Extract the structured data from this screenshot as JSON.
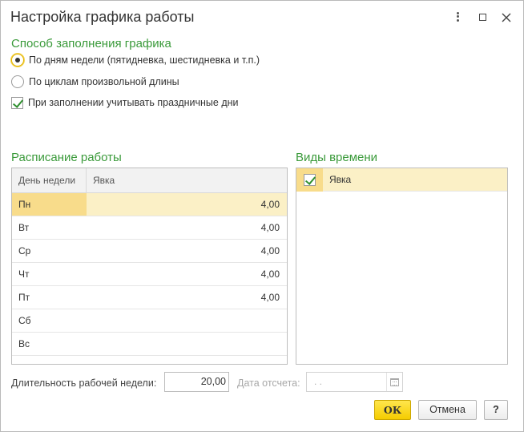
{
  "window": {
    "title": "Настройка графика работы",
    "controls": {
      "more_icon": "vertical-dots-icon",
      "maximize_icon": "maximize-icon",
      "close_icon": "close-icon"
    }
  },
  "fill_method": {
    "title": "Способ заполнения графика",
    "option_by_weekdays": "По дням недели (пятидневка, шестидневка и т.п.)",
    "option_by_cycles": "По циклам произвольной длины",
    "selected": "option_by_weekdays",
    "holidays_checkbox": {
      "label": "При заполнении учитывать праздничные дни",
      "checked": true
    }
  },
  "schedule": {
    "title": "Расписание работы",
    "columns": {
      "day": "День недели",
      "value": "Явка"
    },
    "rows": [
      {
        "day": "Пн",
        "value": "4,00"
      },
      {
        "day": "Вт",
        "value": "4,00"
      },
      {
        "day": "Ср",
        "value": "4,00"
      },
      {
        "day": "Чт",
        "value": "4,00"
      },
      {
        "day": "Пт",
        "value": "4,00"
      },
      {
        "day": "Сб",
        "value": ""
      },
      {
        "day": "Вс",
        "value": ""
      }
    ],
    "active_row": 0
  },
  "time_types": {
    "title": "Виды времени",
    "items": [
      {
        "label": "Явка",
        "checked": true
      }
    ]
  },
  "footer": {
    "duration_label": "Длительность рабочей недели:",
    "duration_value": "20,00",
    "date_label": "Дата отсчета:",
    "date_value": " .  .",
    "ok_label": "ОК",
    "cancel_label": "Отмена",
    "help_label": "?"
  },
  "colors": {
    "section_title": "#3a9a3a",
    "active_row_bg": "#fbf0c6",
    "active_cell_bg": "#f8dc8b",
    "ok_button": "#f5cc00"
  }
}
